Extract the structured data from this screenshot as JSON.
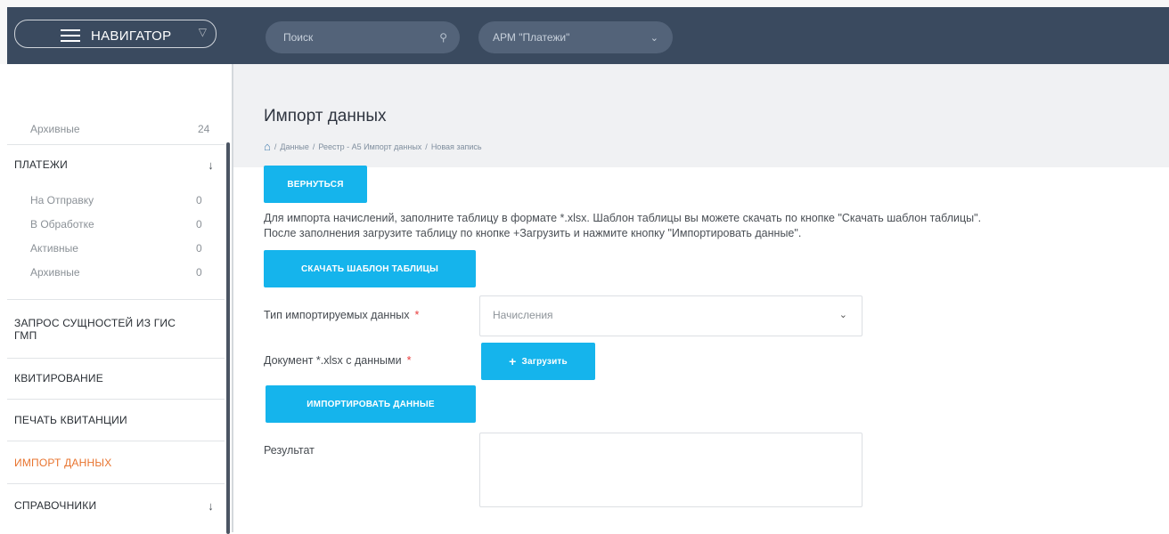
{
  "nav": {
    "brand": "НАВИГАТОР"
  },
  "header": {
    "search_placeholder": "Поиск",
    "arm_selected": "АРМ \"Платежи\""
  },
  "sidebar": {
    "top_item": {
      "label": "Архивные",
      "count": "24"
    },
    "payments": {
      "title": "ПЛАТЕЖИ",
      "items": [
        {
          "label": "На Отправку",
          "count": "0"
        },
        {
          "label": "В Обработке",
          "count": "0"
        },
        {
          "label": "Активные",
          "count": "0"
        },
        {
          "label": "Архивные",
          "count": "0"
        }
      ]
    },
    "sections": [
      {
        "label": "ЗАПРОС СУЩНОСТЕЙ ИЗ ГИС ГМП"
      },
      {
        "label": "КВИТИРОВАНИЕ"
      },
      {
        "label": "ПЕЧАТЬ КВИТАНЦИИ"
      },
      {
        "label": "ИМПОРТ ДАННЫХ"
      },
      {
        "label": "СПРАВОЧНИКИ"
      }
    ]
  },
  "page": {
    "title": "Импорт данных",
    "breadcrumbs": [
      "Данные",
      "Реестр - А5 Импорт данных",
      "Новая запись"
    ],
    "back_button": "ВЕРНУТЬСЯ",
    "info_line1": "Для импорта начислений, заполните таблицу в формате *.xlsx. Шаблон таблицы вы можете скачать по кнопке \"Скачать шаблон таблицы\".",
    "info_line2": "После заполнения загрузите таблицу по кнопке +Загрузить и нажмите кнопку \"Импортировать данные\".",
    "download_button": "СКАЧАТЬ ШАБЛОН ТАБЛИЦЫ",
    "type_label": "Тип импортируемых данных",
    "type_value": "Начисления",
    "doc_label": "Документ *.xlsx с данными",
    "upload_button": "Загрузить",
    "import_button": "ИМПОРТИРОВАТЬ ДАННЫЕ",
    "result_label": "Результат",
    "required_mark": "*"
  },
  "colors": {
    "accent": "#15b4ec",
    "nav": "#3a4a5f",
    "active": "#e8742f"
  }
}
